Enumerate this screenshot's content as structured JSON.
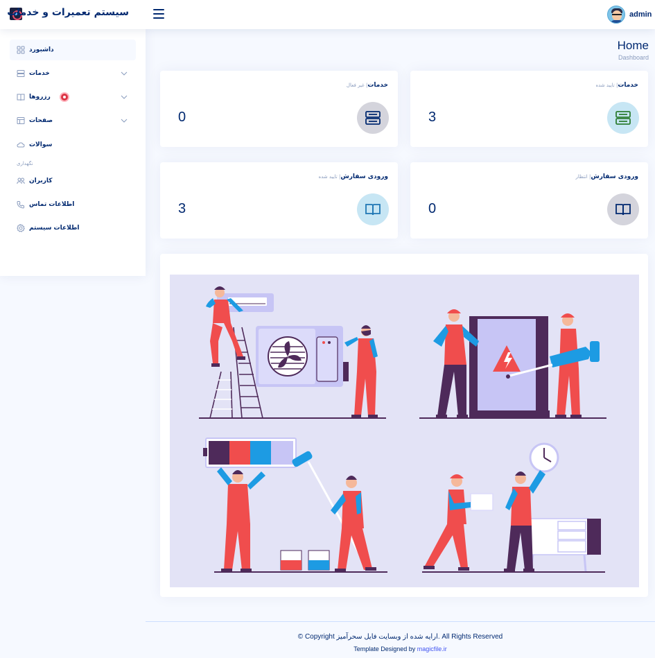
{
  "header": {
    "brand_title": "سیستم تعمیرات و خدمات",
    "username": "admin",
    "user_caret": "▾"
  },
  "sidebar": {
    "items": [
      {
        "label": "داشبورد",
        "icon": "grid-icon",
        "active": true
      },
      {
        "label": "خدمات",
        "icon": "server-icon",
        "has_children": true
      },
      {
        "label": "رزروها",
        "icon": "book-icon",
        "has_children": true,
        "badge": true
      },
      {
        "label": "صفحات",
        "icon": "layout-icon",
        "has_children": true
      },
      {
        "label": "سوالات",
        "icon": "cloud-icon"
      }
    ],
    "heading": "نگهداری",
    "items2": [
      {
        "label": "کاربران",
        "icon": "people-icon"
      },
      {
        "label": "اطلاعات تماس",
        "icon": "phone-icon"
      },
      {
        "label": "اطلاعات سیستم",
        "icon": "gear-icon"
      }
    ]
  },
  "page": {
    "title": "Home",
    "breadcrumb": "Dashboard"
  },
  "cards": [
    {
      "title": "خدمات",
      "sub": "تایید شده",
      "value": "3",
      "icon": "server-icon",
      "icon_bg": "#c7e6f4",
      "icon_color": "#2e7d32"
    },
    {
      "title": "خدمات",
      "sub": "غیر فعال",
      "value": "0",
      "icon": "server-icon",
      "icon_bg": "#d4d4dc",
      "icon_color": "#012970"
    },
    {
      "title": "ورودی سفارش",
      "sub": "انتظار",
      "value": "0",
      "icon": "book-icon",
      "icon_bg": "#d4d4dc",
      "icon_color": "#012970"
    },
    {
      "title": "ورودی سفارش",
      "sub": "تایید شده",
      "value": "3",
      "icon": "book-icon",
      "icon_bg": "#c7e6f4",
      "icon_color": "#1f77b4"
    }
  ],
  "footer": {
    "copyright": "© Copyright ارایه شده از وبسایت فایل سحرآمیز. All Rights Reserved",
    "credits_prefix": "Template Designed by ",
    "credits_link": "magicfile.ir"
  },
  "colors": {
    "primary": "#012970",
    "muted": "#899bbd",
    "background": "#f6f9ff",
    "illustration_bg": "#e3e3f6",
    "worker_red": "#f04d4d",
    "worker_blue": "#1d9be3",
    "dark_purple": "#4e2a5a"
  }
}
